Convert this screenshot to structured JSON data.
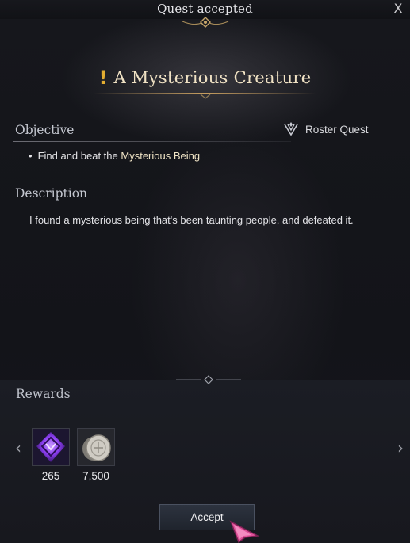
{
  "window": {
    "title": "Quest accepted",
    "close_label": "X"
  },
  "quest": {
    "mark": "!",
    "title": "A Mysterious Creature",
    "type_label": "Roster Quest"
  },
  "objective": {
    "heading": "Objective",
    "bullet": "•",
    "text_prefix": "Find and beat the",
    "target": "Mysterious Being"
  },
  "description": {
    "heading": "Description",
    "text": "I found a mysterious being that's been taunting people, and defeated it."
  },
  "rewards": {
    "heading": "Rewards",
    "prev_arrow": "‹",
    "next_arrow": "›",
    "items": [
      {
        "icon": "purple-gem-icon",
        "quantity": "265"
      },
      {
        "icon": "silver-coin-icon",
        "quantity": "7,500"
      }
    ]
  },
  "actions": {
    "accept_label": "Accept"
  },
  "colors": {
    "accent_gold": "#e3ad31",
    "title_text": "#f0e2c4",
    "purple_reward": "#8a3df0"
  }
}
